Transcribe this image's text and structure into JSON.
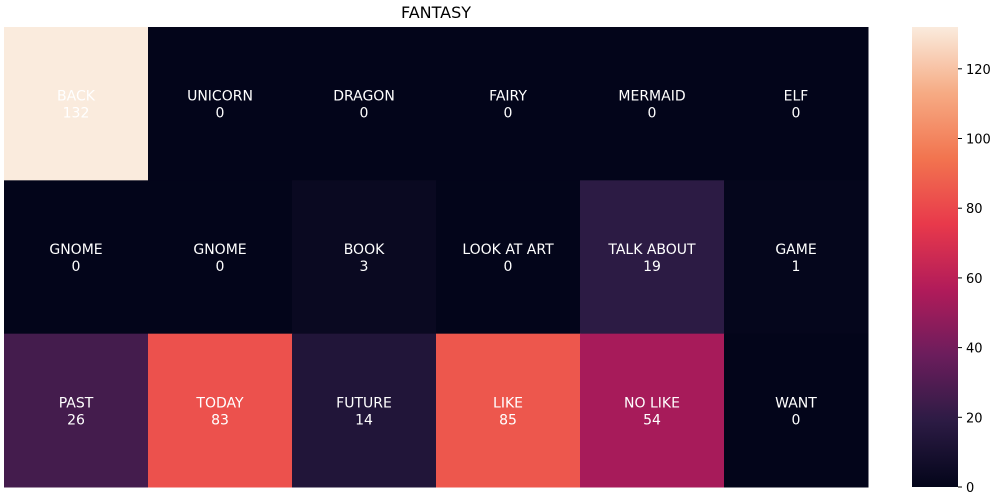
{
  "chart_data": {
    "type": "heatmap",
    "title": "FANTASY",
    "rows": 3,
    "cols": 6,
    "cells": [
      [
        {
          "label": "BACK",
          "value": 132
        },
        {
          "label": "UNICORN",
          "value": 0
        },
        {
          "label": "DRAGON",
          "value": 0
        },
        {
          "label": "FAIRY",
          "value": 0
        },
        {
          "label": "MERMAID",
          "value": 0
        },
        {
          "label": "ELF",
          "value": 0
        }
      ],
      [
        {
          "label": "GNOME",
          "value": 0
        },
        {
          "label": "GNOME",
          "value": 0
        },
        {
          "label": "BOOK",
          "value": 3
        },
        {
          "label": "LOOK AT ART",
          "value": 0
        },
        {
          "label": "TALK ABOUT",
          "value": 19
        },
        {
          "label": "GAME",
          "value": 1
        }
      ],
      [
        {
          "label": "PAST",
          "value": 26
        },
        {
          "label": "TODAY",
          "value": 83
        },
        {
          "label": "FUTURE",
          "value": 14
        },
        {
          "label": "LIKE",
          "value": 85
        },
        {
          "label": "NO LIKE",
          "value": 54
        },
        {
          "label": "WANT",
          "value": 0
        }
      ]
    ],
    "colorbar": {
      "range": [
        0,
        132
      ],
      "ticks": [
        0,
        20,
        40,
        60,
        80,
        100,
        120
      ],
      "colormap": "rocket",
      "stops": [
        "#03051a",
        "#2c1b44",
        "#6b1d5c",
        "#b11b5a",
        "#e8394b",
        "#f2744f",
        "#f6ab84",
        "#faebdd"
      ]
    },
    "grid": false,
    "legend": "colorbar-right"
  }
}
